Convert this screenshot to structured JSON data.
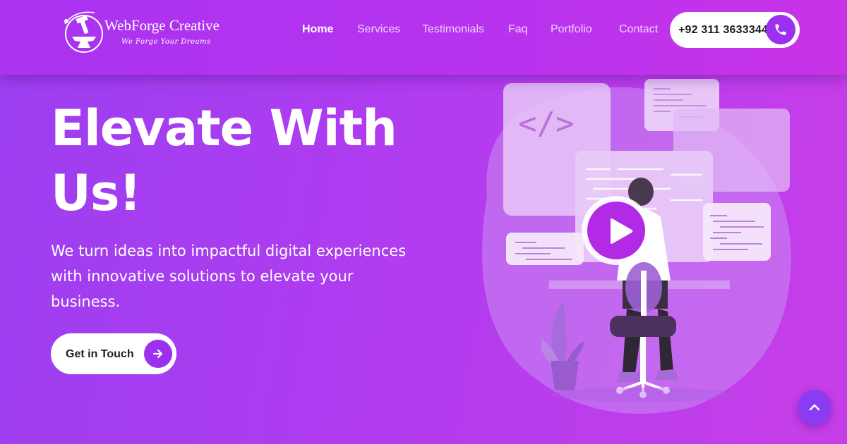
{
  "colors": {
    "accent": "#9c2ff0",
    "header_bg": "#b233ef",
    "hero_bg_start": "#9b3ff0",
    "hero_bg_end": "#c73ee8",
    "button_bg": "#ffffff",
    "button_text": "#1d1d1d"
  },
  "brand": {
    "name": "WebForge Creative",
    "tagline": "We Forge Your Dreams",
    "logo_icon": "anvil-hammer-logo-icon"
  },
  "nav": {
    "items": [
      {
        "label": "Home",
        "active": true
      },
      {
        "label": "Services",
        "active": false
      },
      {
        "label": "Testimonials",
        "active": false
      },
      {
        "label": "Faq",
        "active": false
      },
      {
        "label": "Portfolio",
        "active": false
      },
      {
        "label": "Contact",
        "active": false
      }
    ]
  },
  "contact": {
    "phone": "+92 311 3633344",
    "phone_icon": "phone-icon"
  },
  "hero": {
    "title_line1": "Elevate With",
    "title_line2": "Us!",
    "description": "We turn ideas into impactful digital experiences with innovative solutions to elevate your business.",
    "cta_label": "Get in Touch",
    "cta_icon": "arrow-right-icon"
  },
  "illustration": {
    "code_symbol": "</>",
    "play_icon": "play-icon"
  },
  "scroll_top": {
    "icon": "chevron-up-icon"
  }
}
